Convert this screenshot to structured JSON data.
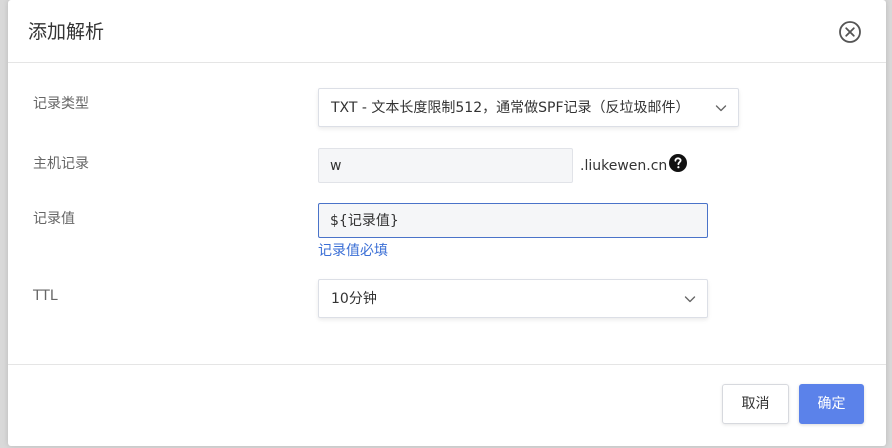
{
  "dialog": {
    "title": "添加解析",
    "close_icon": "close-circle-icon"
  },
  "form": {
    "record_type": {
      "label": "记录类型",
      "value": "TXT - 文本长度限制512，通常做SPF记录（反垃圾邮件）"
    },
    "host": {
      "label": "主机记录",
      "value": "w",
      "suffix": ".liukewen.cn",
      "help_icon": "question-circle-icon"
    },
    "record_value": {
      "label": "记录值",
      "value": "${记录值}",
      "error": "记录值必填"
    },
    "ttl": {
      "label": "TTL",
      "value": "10分钟"
    }
  },
  "footer": {
    "cancel_label": "取消",
    "confirm_label": "确定"
  },
  "colors": {
    "primary": "#5b82ea",
    "error_link": "#3b6fd6",
    "focus_border": "#4a73c9"
  }
}
